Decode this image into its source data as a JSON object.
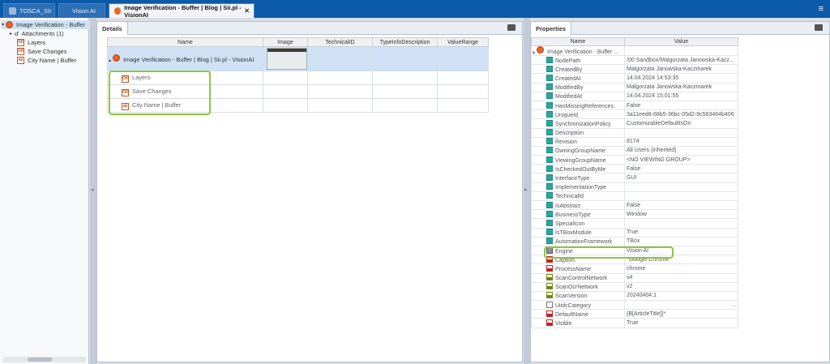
{
  "tabs": [
    {
      "label": "TOSCA_SII"
    },
    {
      "label": "Vision AI"
    },
    {
      "label": "Image Verification - Buffer | Blog | Sii.pl - VisionAI"
    }
  ],
  "tree": {
    "root": "Image Verification - Buffer",
    "items": [
      "Attachments (1)",
      "Layers",
      "Save Changes",
      "City Name | Buffer"
    ]
  },
  "details": {
    "tab_label": "Details",
    "columns": [
      "Name",
      "Image",
      "TechnicalID",
      "TypeInfoDescription",
      "ValueRange"
    ],
    "root_name": "Image Verification - Buffer | Blog | Sii.pl - VisionAI",
    "children": [
      "Layers",
      "Save Changes",
      "City Name | Buffer"
    ]
  },
  "properties": {
    "tab_label": "Properties",
    "columns": [
      "Name",
      "Value"
    ],
    "root": "Image Verification - Buffer ...",
    "rows": [
      {
        "name": "NodePath",
        "value": "/00 Sandbox/Malgorzata Janowska-Kacz..."
      },
      {
        "name": "CreatedBy",
        "value": "Malgorzata Janowska-Kaczmarek"
      },
      {
        "name": "CreatedAt",
        "value": "14.04.2024 14:53:35"
      },
      {
        "name": "ModifiedBy",
        "value": "Malgorzata Janowska-Kaczmarek"
      },
      {
        "name": "ModifiedAt",
        "value": "14.04.2024 15:01:55"
      },
      {
        "name": "HasMissingReferences",
        "value": "False"
      },
      {
        "name": "UniqueId",
        "value": "3a11eed8-68b5-36bc-05d2-9c583464b406"
      },
      {
        "name": "SynchronizationPolicy",
        "value": "CustomizableDefaultIsOn"
      },
      {
        "name": "Description",
        "value": ""
      },
      {
        "name": "Revision",
        "value": "8174"
      },
      {
        "name": "OwningGroupName",
        "value": "All Users (inherited)"
      },
      {
        "name": "ViewingGroupName",
        "value": "<NO VIEWING GROUP>"
      },
      {
        "name": "IsCheckedOutByMe",
        "value": "False"
      },
      {
        "name": "InterfaceType",
        "value": "GUI"
      },
      {
        "name": "ImplementationType",
        "value": ""
      },
      {
        "name": "TechnicalId",
        "value": ""
      },
      {
        "name": "IsAbstract",
        "value": "False"
      },
      {
        "name": "BusinessType",
        "value": "Window"
      },
      {
        "name": "SpecialIcon",
        "value": ""
      },
      {
        "name": "IsTBoxModule",
        "value": "True"
      },
      {
        "name": "AutomationFramework",
        "value": "TBox"
      },
      {
        "name": "Engine",
        "value": "Vision AI"
      },
      {
        "name": "Caption",
        "value": "*Google Chrome"
      },
      {
        "name": "ProcessName",
        "value": "chrome"
      },
      {
        "name": "ScanControlNetwork",
        "value": "v4"
      },
      {
        "name": "ScanOcrNetwork",
        "value": "v2"
      },
      {
        "name": "ScanVersion",
        "value": "20240404.1"
      },
      {
        "name": "UiidcCategory",
        "value": ""
      },
      {
        "name": "DefaultName",
        "value": "{B[ArticleTitle]}*"
      },
      {
        "name": "Visible",
        "value": "True"
      }
    ],
    "more": "..."
  }
}
